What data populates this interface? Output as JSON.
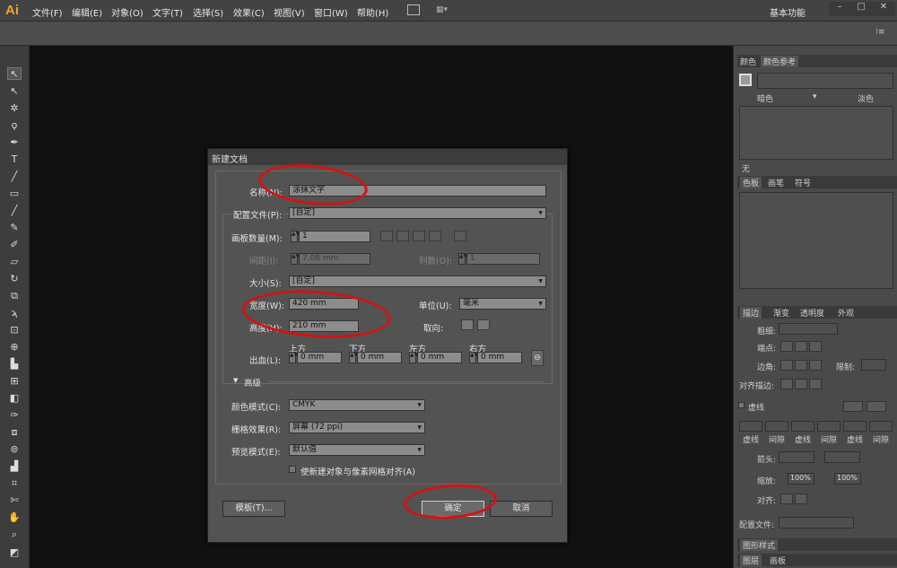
{
  "app": {
    "logo": "Ai",
    "workspace": "基本功能",
    "menus": [
      "文件(F)",
      "编辑(E)",
      "对象(O)",
      "文字(T)",
      "选择(S)",
      "效果(C)",
      "视图(V)",
      "窗口(W)",
      "帮助(H)"
    ]
  },
  "panels": {
    "color_tabs": [
      "颜色",
      "颜色参考"
    ],
    "color_dark": "暗色",
    "color_light": "淡色",
    "color_none": "无",
    "swatch_tabs": [
      "色板",
      "画笔",
      "符号"
    ],
    "stroke_tabs": [
      "描边",
      "渐变",
      "透明度",
      "外观"
    ],
    "stroke": {
      "weight": "粗细:",
      "cap": "端点:",
      "corner": "边角:",
      "limit": "限制:",
      "align": "对齐描边:",
      "dashed": "虚线",
      "dash_labels": [
        "虚线",
        "间隙",
        "虚线",
        "间隙",
        "虚线",
        "间隙"
      ],
      "arrow": "箭头:",
      "scale": "缩放:",
      "scale_val1": "100%",
      "scale_val2": "100%",
      "align2": "对齐:",
      "profile": "配置文件:"
    },
    "graphic_styles": "图形样式",
    "layer_tabs": [
      "图层",
      "画板"
    ]
  },
  "dialog": {
    "title": "新建文档",
    "name_label": "名称(N):",
    "name_value": "涂抹文字",
    "profile_label": "配置文件(P):",
    "profile_value": "[自定]",
    "artboards_label": "画板数量(M):",
    "artboards_value": "1",
    "spacing_label": "间距(I):",
    "spacing_value": "7.06 mm",
    "columns_label": "列数(O):",
    "columns_value": "1",
    "size_label": "大小(S):",
    "size_value": "[自定]",
    "width_label": "宽度(W):",
    "width_value": "420 mm",
    "unit_label": "单位(U):",
    "unit_value": "毫米",
    "height_label": "高度(H):",
    "height_value": "210 mm",
    "orient_label": "取向:",
    "bleed_label": "出血(L):",
    "bleed_top": "上方",
    "bleed_bottom": "下方",
    "bleed_left": "左方",
    "bleed_right": "右方",
    "bleed_top_val": "0 mm",
    "bleed_bottom_val": "0 mm",
    "bleed_left_val": "0 mm",
    "bleed_right_val": "0 mm",
    "advanced_label": "高级",
    "colormode_label": "颜色模式(C):",
    "colormode_value": "CMYK",
    "raster_label": "栅格效果(R):",
    "raster_value": "屏幕 (72 ppi)",
    "preview_label": "预览模式(E):",
    "preview_value": "默认值",
    "align_pixel_label": "使新建对象与像素网格对齐(A)",
    "template_button": "模板(T)...",
    "ok_button": "确定",
    "cancel_button": "取消"
  },
  "colors": {
    "annotation": "#d41212",
    "accent": "#f7a21b"
  }
}
